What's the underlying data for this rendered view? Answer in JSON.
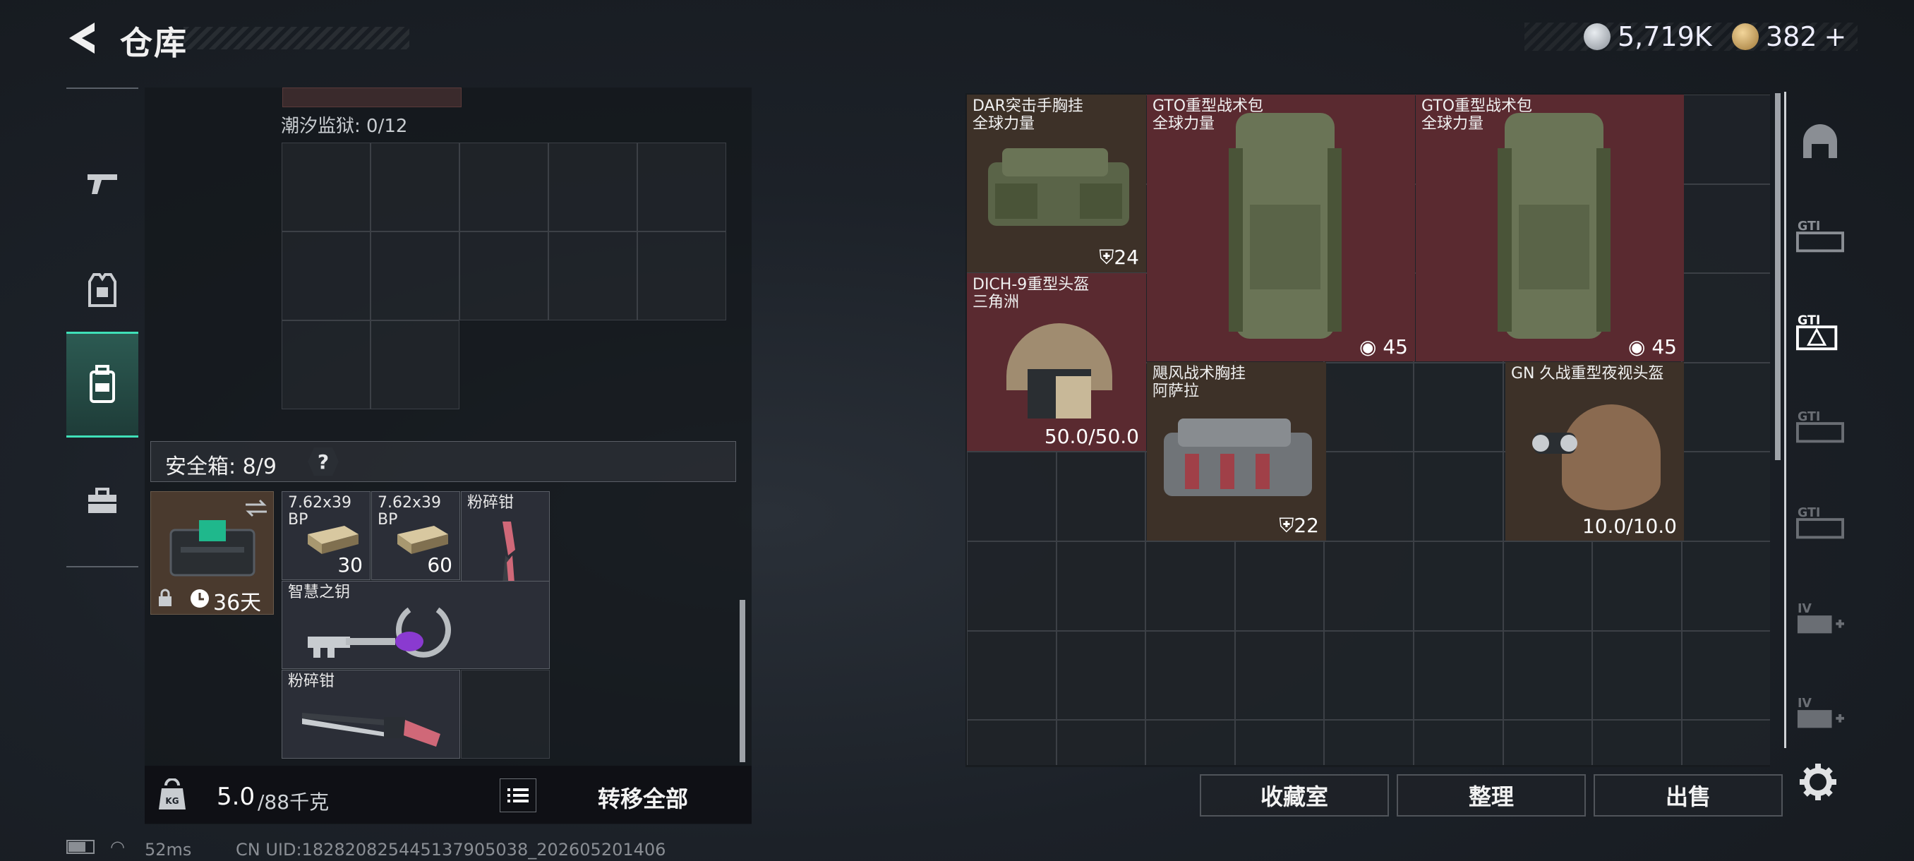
{
  "header": {
    "title": "仓库",
    "currency1": "5,719K",
    "currency2": "382",
    "currency2_plus": "+"
  },
  "nav": {
    "items": [
      {
        "name": "weapons",
        "icon": "gun-icon"
      },
      {
        "name": "armor",
        "icon": "armor-vest-icon"
      },
      {
        "name": "backpack",
        "icon": "backpack-icon",
        "active": true
      },
      {
        "name": "toolbox",
        "icon": "toolbox-icon"
      }
    ]
  },
  "left": {
    "prison_label": "潮汐监狱: 0/12",
    "safe_label": "安全箱: 8/9",
    "safe_help": "?",
    "safe_timer": "36天",
    "items": [
      {
        "name": "7.62x39",
        "sub": "BP",
        "qty": "30"
      },
      {
        "name": "7.62x39",
        "sub": "BP",
        "qty": "60"
      },
      {
        "name": "粉碎钳",
        "qty": ""
      },
      {
        "name": "智慧之钥",
        "qty": ""
      },
      {
        "name": "粉碎钳",
        "qty": ""
      }
    ],
    "weight_value": "5.0",
    "weight_total": "/88千克",
    "transfer_all": "转移全部"
  },
  "right": {
    "items": [
      {
        "name": "DAR突击手胸挂",
        "sub": "全球力量",
        "value": "24"
      },
      {
        "name": "GTO重型战术包",
        "sub": "全球力量",
        "value": "45"
      },
      {
        "name": "GTO重型战术包",
        "sub": "全球力量",
        "value": "45"
      },
      {
        "name": "DICH-9重型头盔",
        "sub": "三角洲",
        "value": "50.0/50.0"
      },
      {
        "name": "飓风战术胸挂",
        "sub": "阿萨拉",
        "value": "22"
      },
      {
        "name": "GN 久战重型夜视头盔",
        "sub": "",
        "value": "10.0/10.0"
      }
    ],
    "buttons": {
      "collection": "收藏室",
      "organize": "整理",
      "sell": "出售"
    },
    "tabs": [
      "",
      "GTI",
      "GTI",
      "GTI",
      "GTI",
      "IV",
      "IV"
    ]
  },
  "status": {
    "ping": "52ms",
    "uid": "CN UID:18282082544513790503​8_202605201406"
  },
  "colors": {
    "accent": "#3fe0b8",
    "red_item": "#5a2a30",
    "brown_item": "#3d3128"
  }
}
